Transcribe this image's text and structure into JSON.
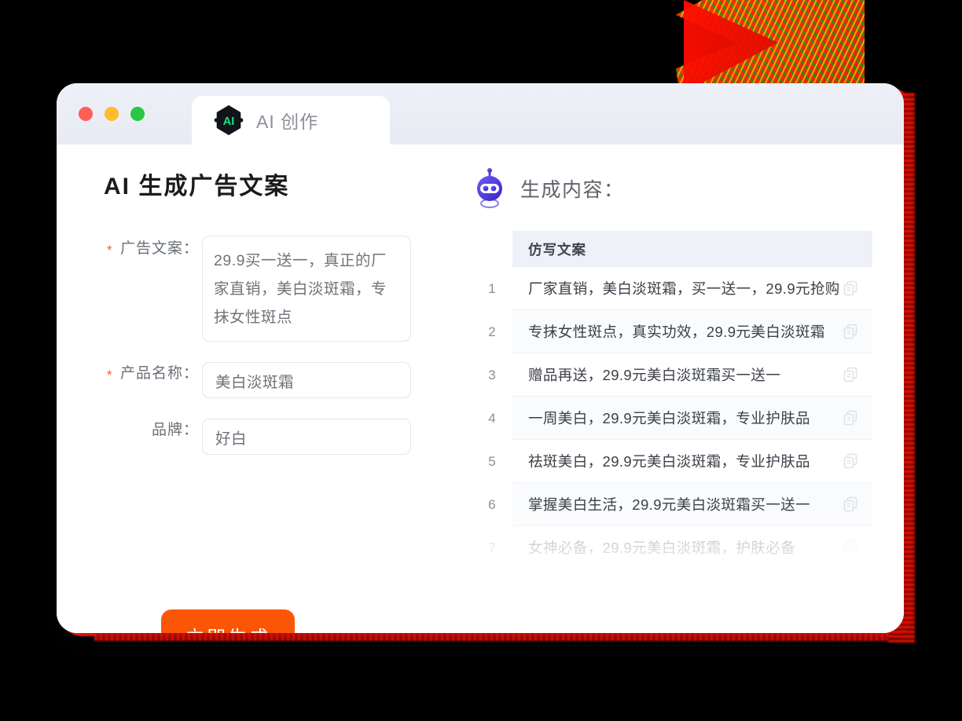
{
  "window": {
    "traffic_lights": [
      "close",
      "minimize",
      "maximize"
    ],
    "tab": {
      "label": "AI 创作",
      "logo_text": "AI"
    }
  },
  "left_panel": {
    "title": "AI 生成广告文案",
    "fields": [
      {
        "label": "广告文案：",
        "required": true,
        "value": "29.9买一送一，真正的厂家直销，美白淡斑霜，专抹女性斑点",
        "type": "textarea",
        "placeholder": ""
      },
      {
        "label": "产品名称：",
        "required": true,
        "value": "美白淡斑霜",
        "type": "input",
        "placeholder": ""
      },
      {
        "label": "品牌：",
        "required": false,
        "value": "好白",
        "type": "input",
        "placeholder": ""
      }
    ],
    "submit_label": "立即生成"
  },
  "right_panel": {
    "title": "生成内容：",
    "table_header": "仿写文案",
    "rows": [
      {
        "num": "1",
        "text": "厂家直销，美白淡斑霜，买一送一，29.9元抢购"
      },
      {
        "num": "2",
        "text": "专抹女性斑点，真实功效，29.9元美白淡斑霜"
      },
      {
        "num": "3",
        "text": "赠品再送，29.9元美白淡斑霜买一送一"
      },
      {
        "num": "4",
        "text": "一周美白，29.9元美白淡斑霜，专业护肤品"
      },
      {
        "num": "5",
        "text": "祛斑美白，29.9元美白淡斑霜，专业护肤品"
      },
      {
        "num": "6",
        "text": "掌握美白生活，29.9元美白淡斑霜买一送一"
      },
      {
        "num": "7",
        "text": "女神必备，29.9元美白淡斑霜，护肤必备"
      }
    ]
  },
  "colors": {
    "accent_orange": "#fb5607",
    "required_star": "#ff5a2b",
    "logo_green": "#1fdc8a",
    "robot_blue": "#4b3ddc",
    "glow_red": "#ff1400",
    "titlebar": "#eef0f7",
    "table_header_bg": "#eef1f8"
  }
}
